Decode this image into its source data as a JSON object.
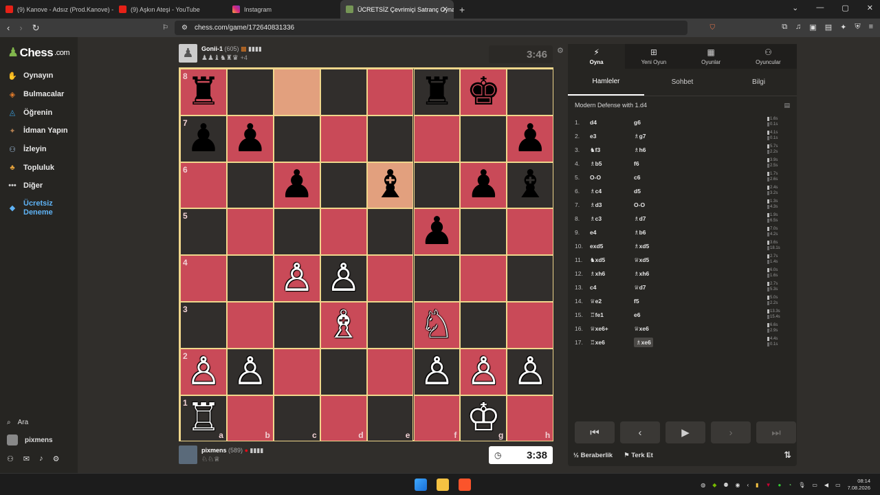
{
  "browser": {
    "tabs": [
      {
        "label": "(9) Kanove - Adsız (Prod.Kanove) - Yo",
        "icon": "youtube-icon",
        "active": false
      },
      {
        "label": "(9) Aşkın Ateşi - YouTube",
        "icon": "youtube-icon",
        "active": false
      },
      {
        "label": "Instagram",
        "icon": "instagram-icon",
        "active": false
      },
      {
        "label": "ÜCRETSİZ Çevrimiçi Satranç Oyna",
        "icon": "chess-icon",
        "active": true
      }
    ],
    "url": "chess.com/game/172640831336"
  },
  "sidebar": {
    "logo": "Chess",
    "logo_suffix": ".com",
    "items": [
      {
        "label": "Oynayın",
        "icon": "play-hand-icon",
        "color": "#d9a441"
      },
      {
        "label": "Bulmacalar",
        "icon": "puzzle-icon",
        "color": "#e57d2b"
      },
      {
        "label": "Öğrenin",
        "icon": "graduation-cap-icon",
        "color": "#3aa0e0"
      },
      {
        "label": "İdman Yapın",
        "icon": "training-icon",
        "color": "#b07d4f"
      },
      {
        "label": "İzleyin",
        "icon": "binoculars-icon",
        "color": "#a7c6e8"
      },
      {
        "label": "Topluluk",
        "icon": "community-icon",
        "color": "#e5a23b"
      },
      {
        "label": "Diğer",
        "icon": "more-dots-icon",
        "color": "#cccccc"
      }
    ],
    "trial": {
      "line1": "Ücretsiz",
      "line2": "Deneme"
    },
    "search_label": "Ara",
    "username": "pixmens"
  },
  "top_player": {
    "name": "Gonii-1",
    "rating": "(605)",
    "captured": "♟♟♝♞♜♛",
    "advantage": "+4",
    "clock": "3:46"
  },
  "bottom_player": {
    "name": "pixmens",
    "rating": "(589)",
    "captured": "♘♘♕",
    "clock": "3:38"
  },
  "board": {
    "files": [
      "a",
      "b",
      "c",
      "d",
      "e",
      "f",
      "g",
      "h"
    ],
    "ranks": [
      "8",
      "7",
      "6",
      "5",
      "4",
      "3",
      "2",
      "1"
    ],
    "highlight": [
      "c8",
      "e6"
    ],
    "pieces": {
      "a8": "♜b",
      "f8": "♜b",
      "g8": "♚b",
      "a7": "♟b",
      "b7": "♟b",
      "h7": "♟b",
      "c6": "♟b",
      "e6": "♝b",
      "g6": "♟b",
      "h6": "♝b",
      "f5": "♟b",
      "c4": "♙w",
      "d4": "♙w",
      "d3": "♗w",
      "f3": "♘w",
      "a2": "♙w",
      "b2": "♙w",
      "f2": "♙w",
      "g2": "♙w",
      "h2": "♙w",
      "a1": "♖w",
      "g1": "♔w"
    }
  },
  "panel": {
    "top_tabs": [
      {
        "label": "Oyna",
        "icon": "lightning-icon"
      },
      {
        "label": "Yeni Oyun",
        "icon": "plus-square-icon"
      },
      {
        "label": "Oyunlar",
        "icon": "board-grid-icon"
      },
      {
        "label": "Oyuncular",
        "icon": "players-icon"
      }
    ],
    "sub_tabs": [
      "Hamleler",
      "Sohbet",
      "Bilgi"
    ],
    "opening": "Modern Defense with 1.d4",
    "moves": [
      {
        "n": "1.",
        "w": "d4",
        "b": "g6",
        "tw": "1.6s",
        "tb": "0.1s"
      },
      {
        "n": "2.",
        "w": "e3",
        "b": "♗g7",
        "tw": "4.1s",
        "tb": "0.1s"
      },
      {
        "n": "3.",
        "w": "♞f3",
        "b": "♗h6",
        "tw": "5.7s",
        "tb": "2.2s"
      },
      {
        "n": "4.",
        "w": "♗b5",
        "b": "f6",
        "tw": "3.9s",
        "tb": "2.5s"
      },
      {
        "n": "5.",
        "w": "O-O",
        "b": "c6",
        "tw": "1.7s",
        "tb": "2.6s"
      },
      {
        "n": "6.",
        "w": "♗c4",
        "b": "d5",
        "tw": "2.4s",
        "tb": "3.2s"
      },
      {
        "n": "7.",
        "w": "♗d3",
        "b": "O-O",
        "tw": "1.3s",
        "tb": "4.3s"
      },
      {
        "n": "8.",
        "w": "♗c3",
        "b": "♗d7",
        "tw": "1.9s",
        "tb": "6.5s"
      },
      {
        "n": "9.",
        "w": "e4",
        "b": "♗b6",
        "tw": "7.0s",
        "tb": "4.2s"
      },
      {
        "n": "10.",
        "w": "exd5",
        "b": "♗xd5",
        "tw": "3.6s",
        "tb": "18.1s"
      },
      {
        "n": "11.",
        "w": "♞xd5",
        "b": "♕xd5",
        "tw": "2.7s",
        "tb": "1.4s"
      },
      {
        "n": "12.",
        "w": "♗xh6",
        "b": "♗xh6",
        "tw": "6.0s",
        "tb": "1.6s"
      },
      {
        "n": "13.",
        "w": "c4",
        "b": "♕d7",
        "tw": "2.7s",
        "tb": "5.3s"
      },
      {
        "n": "14.",
        "w": "♕e2",
        "b": "f5",
        "tw": "5.0s",
        "tb": "2.2s"
      },
      {
        "n": "15.",
        "w": "♖fe1",
        "b": "e6",
        "tw": "13.3s",
        "tb": "15.4s"
      },
      {
        "n": "16.",
        "w": "♕xe6+",
        "b": "♕xe6",
        "tw": "6.6s",
        "tb": "2.9s"
      },
      {
        "n": "17.",
        "w": "♖xe6",
        "b": "♗xe6",
        "tw": "4.4s",
        "tb": "0.1s"
      }
    ],
    "controls": [
      "first-move-icon",
      "prev-move-icon",
      "play-icon",
      "next-move-icon",
      "last-move-icon"
    ],
    "draw_label": "Beraberlik",
    "draw_prefix": "½",
    "resign_label": "Terk Et"
  },
  "taskbar": {
    "time": "08:14",
    "date": "7.08.2026"
  },
  "colors": {
    "light_square": "#c94a58",
    "dark_square": "#312e2c",
    "highlight": "#e2a07e",
    "border": "#f0d78c"
  }
}
